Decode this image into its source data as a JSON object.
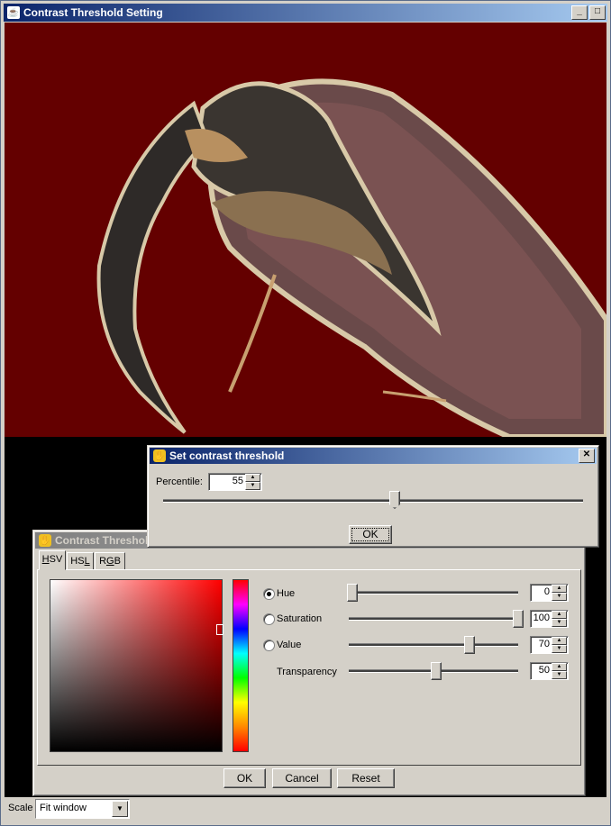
{
  "main_window": {
    "title": "Contrast Threshold Setting",
    "scale_label": "Scale",
    "scale_value": "Fit window"
  },
  "threshold_dialog": {
    "title": "Set contrast threshold",
    "percentile_label": "Percentile:",
    "percentile_value": "55",
    "slider_fraction": 0.55,
    "ok_label": "OK"
  },
  "color_dialog": {
    "title": "Contrast Threshold",
    "tabs": [
      {
        "label": "HSV",
        "hotkey": "H",
        "rest": "SV",
        "selected": true
      },
      {
        "label": "HSL",
        "hotkey": "L",
        "rest": "HS",
        "selected": false
      },
      {
        "label": "RGB",
        "hotkey": "G",
        "rest": "R",
        "selected": false
      }
    ],
    "hue_label": "Hue",
    "hue_value": "0",
    "saturation_label": "Saturation",
    "saturation_value": "100",
    "value_label": "Value",
    "value_value": "70",
    "transparency_label": "Transparency",
    "transparency_value": "50",
    "selected_mode": "Hue",
    "ok_label": "OK",
    "cancel_label": "Cancel",
    "reset_label": "Reset"
  },
  "colors": {
    "image_background": "#640000",
    "selected_color": "#b20000",
    "titlebar_active": "#0a246a"
  }
}
